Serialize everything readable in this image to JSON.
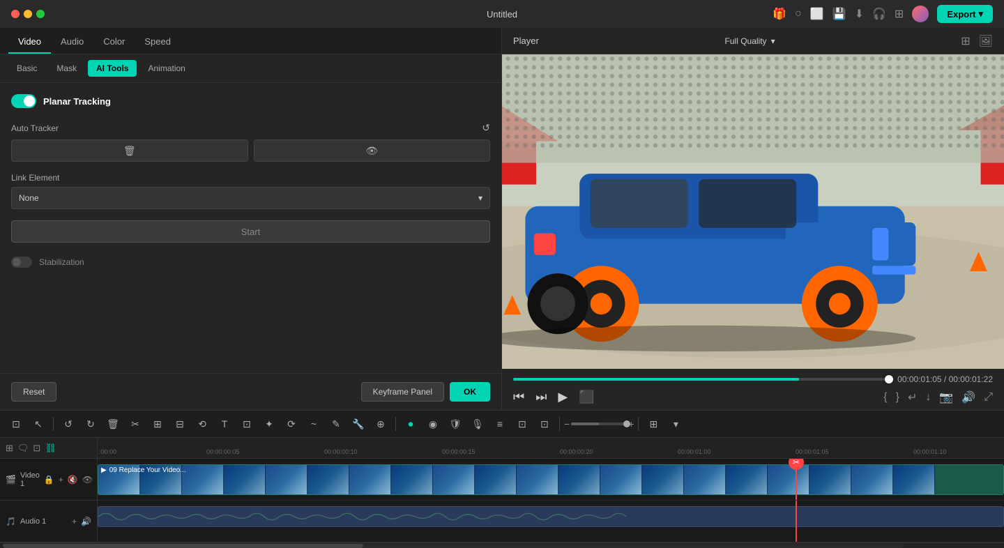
{
  "titlebar": {
    "title": "Untitled",
    "export_label": "Export",
    "export_chevron": "▾"
  },
  "panel": {
    "tabs": [
      {
        "label": "Video",
        "active": true
      },
      {
        "label": "Audio",
        "active": false
      },
      {
        "label": "Color",
        "active": false
      },
      {
        "label": "Speed",
        "active": false
      }
    ],
    "sub_tabs": [
      {
        "label": "Basic",
        "active": false
      },
      {
        "label": "Mask",
        "active": false
      },
      {
        "label": "AI Tools",
        "active": true
      },
      {
        "label": "Animation",
        "active": false
      }
    ],
    "planar_tracking": {
      "label": "Planar Tracking",
      "enabled": true
    },
    "auto_tracker": {
      "label": "Auto Tracker",
      "delete_icon": "🗑",
      "eye_icon": "👁"
    },
    "link_element": {
      "label": "Link Element",
      "value": "None",
      "chevron": "▾"
    },
    "start_btn": "Start",
    "stabilization": {
      "label": "Stabilization",
      "enabled": false
    },
    "reset_btn": "Reset",
    "keyframe_btn": "Keyframe Panel",
    "ok_btn": "OK"
  },
  "player": {
    "title": "Player",
    "quality": "Full Quality",
    "quality_chevron": "▾",
    "current_time": "00:00:01:05",
    "total_time": "00:00:01:22"
  },
  "toolbar": {
    "icons": [
      "⊡",
      "↖",
      "↺",
      "↻",
      "🗑",
      "✂",
      "⊞",
      "⊟",
      "⟲",
      "T",
      "⊡",
      "✦",
      "⟳",
      "⊙",
      "⊠",
      "✎",
      "🔧",
      "⊕",
      "≡",
      "⊡",
      "⊡",
      "⊡",
      "⊡",
      "⊡",
      "⊡",
      "⊡",
      "••",
      "⊡"
    ]
  },
  "timeline": {
    "time_markers": [
      ":00:00",
      "00:00:00:05",
      "00:00:00:10",
      "00:00:00:15",
      "00:00:00:20",
      "00:00:01:00",
      "00:00:01:05",
      "00:00:01:10"
    ],
    "playhead_time": "01:05",
    "video_track": {
      "number": "1",
      "label": "Video 1",
      "clip_label": "09 Replace Your Video..."
    },
    "audio_track": {
      "number": "1",
      "label": "Audio 1"
    }
  }
}
